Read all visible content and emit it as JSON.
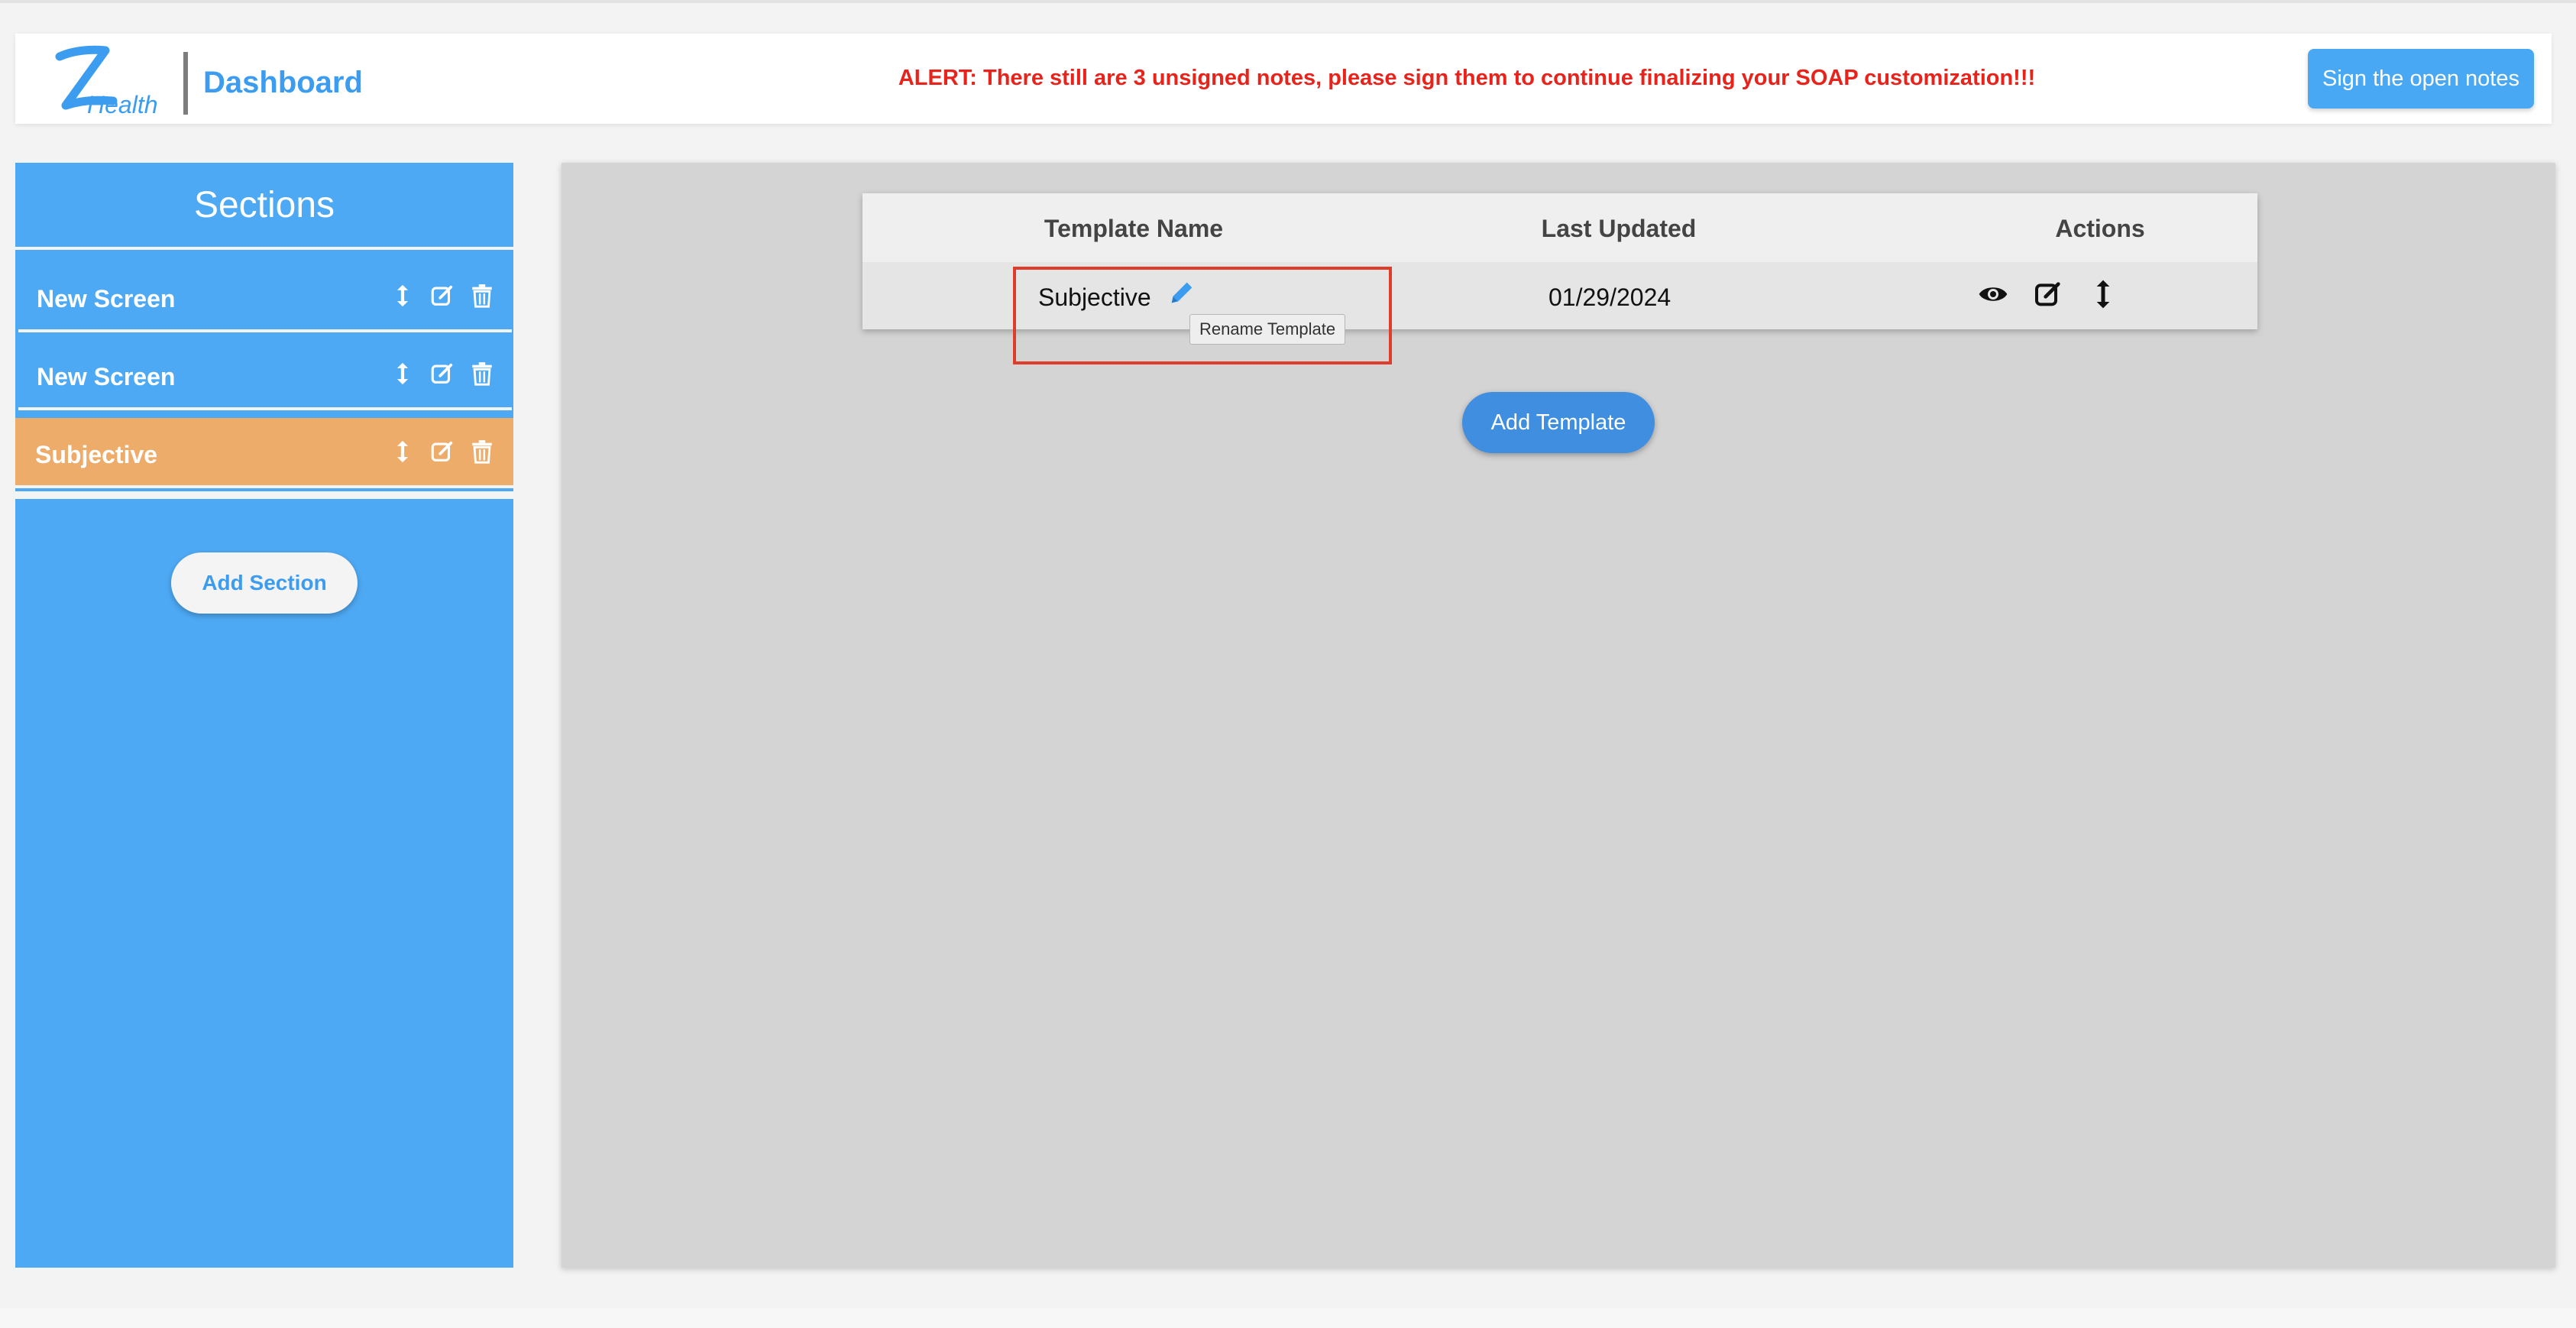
{
  "header": {
    "logo_text": "Health",
    "title": "Dashboard",
    "alert": "ALERT: There still are 3 unsigned notes, please sign them to continue finalizing your SOAP customization!!!",
    "sign_button": "Sign the open notes"
  },
  "sidebar": {
    "title": "Sections",
    "items": [
      {
        "label": "New Screen",
        "active": false,
        "icons": [
          "reorder-icon",
          "edit-icon",
          "delete-icon"
        ]
      },
      {
        "label": "New Screen",
        "active": false,
        "icons": [
          "reorder-icon",
          "edit-icon",
          "delete-icon"
        ]
      },
      {
        "label": "Subjective",
        "active": true,
        "icons": [
          "reorder-icon",
          "edit-icon",
          "delete-icon"
        ]
      }
    ],
    "add_button": "Add Section"
  },
  "table": {
    "headers": [
      "Template Name",
      "Last Updated",
      "Actions"
    ],
    "rows": [
      {
        "name": "Subjective",
        "updated": "01/29/2024",
        "actions": [
          "view-icon",
          "edit-icon",
          "reorder-icon"
        ]
      }
    ],
    "tooltip": "Rename Template"
  },
  "add_template_button": "Add Template",
  "colors": {
    "primary_blue": "#4ea9f4",
    "active_orange": "#eeac6a",
    "alert_red": "#e8231b",
    "highlight_red": "#e03c2c"
  }
}
